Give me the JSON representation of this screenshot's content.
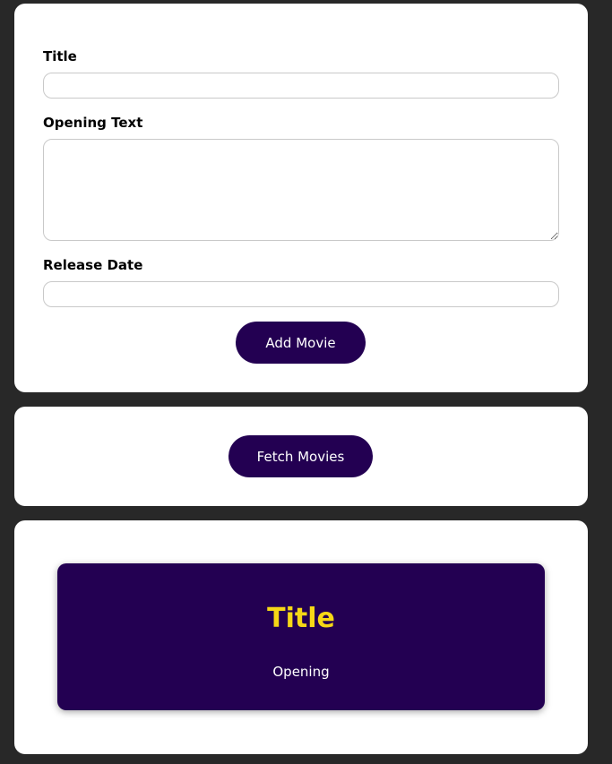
{
  "form": {
    "title_label": "Title",
    "title_value": "",
    "opening_label": "Opening Text",
    "opening_value": "",
    "date_label": "Release Date",
    "date_value": "",
    "add_button": "Add Movie"
  },
  "actions": {
    "fetch_button": "Fetch Movies"
  },
  "movies": [
    {
      "title": "Title",
      "opening": "Opening"
    }
  ],
  "colors": {
    "background": "#282828",
    "button": "#230052",
    "movie_card": "#230052",
    "movie_title": "#f6d816"
  }
}
